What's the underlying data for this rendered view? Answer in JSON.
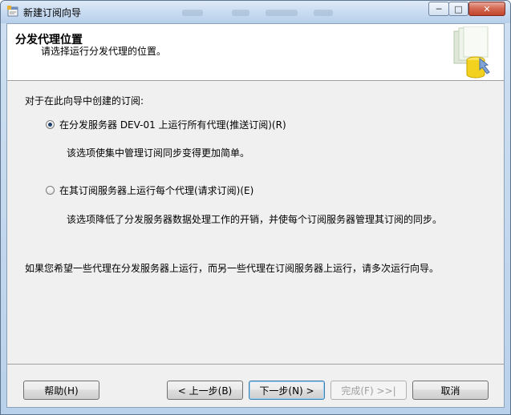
{
  "window": {
    "title": "新建订阅向导",
    "minimize_glyph": "─",
    "maximize_glyph": "□",
    "close_glyph": "✕"
  },
  "header": {
    "title": "分发代理位置",
    "subtitle": "请选择运行分发代理的位置。",
    "graphic_icon": "database-wizard-icon"
  },
  "content": {
    "prompt": "对于在此向导中创建的订阅:",
    "options": [
      {
        "label": "在分发服务器 DEV-01 上运行所有代理(推送订阅)(R)",
        "description": "该选项使集中管理订阅同步变得更加简单。",
        "selected": true
      },
      {
        "label": "在其订阅服务器上运行每个代理(请求订阅)(E)",
        "description": "该选项降低了分发服务器数据处理工作的开销，并使每个订阅服务器管理其订阅的同步。",
        "selected": false
      }
    ],
    "note": "如果您希望一些代理在分发服务器上运行，而另一些代理在订阅服务器上运行，请多次运行向导。"
  },
  "buttons": {
    "help": "帮助(H)",
    "back": "< 上一步(B)",
    "next": "下一步(N) >",
    "finish": "完成(F) >>|",
    "cancel": "取消"
  },
  "colors": {
    "titlebar": "#c9dcf1",
    "client_bg": "#f0f0f0",
    "header_bg": "#ffffff",
    "radio_dot": "#1d3f6b",
    "close_button": "#c2452c"
  }
}
